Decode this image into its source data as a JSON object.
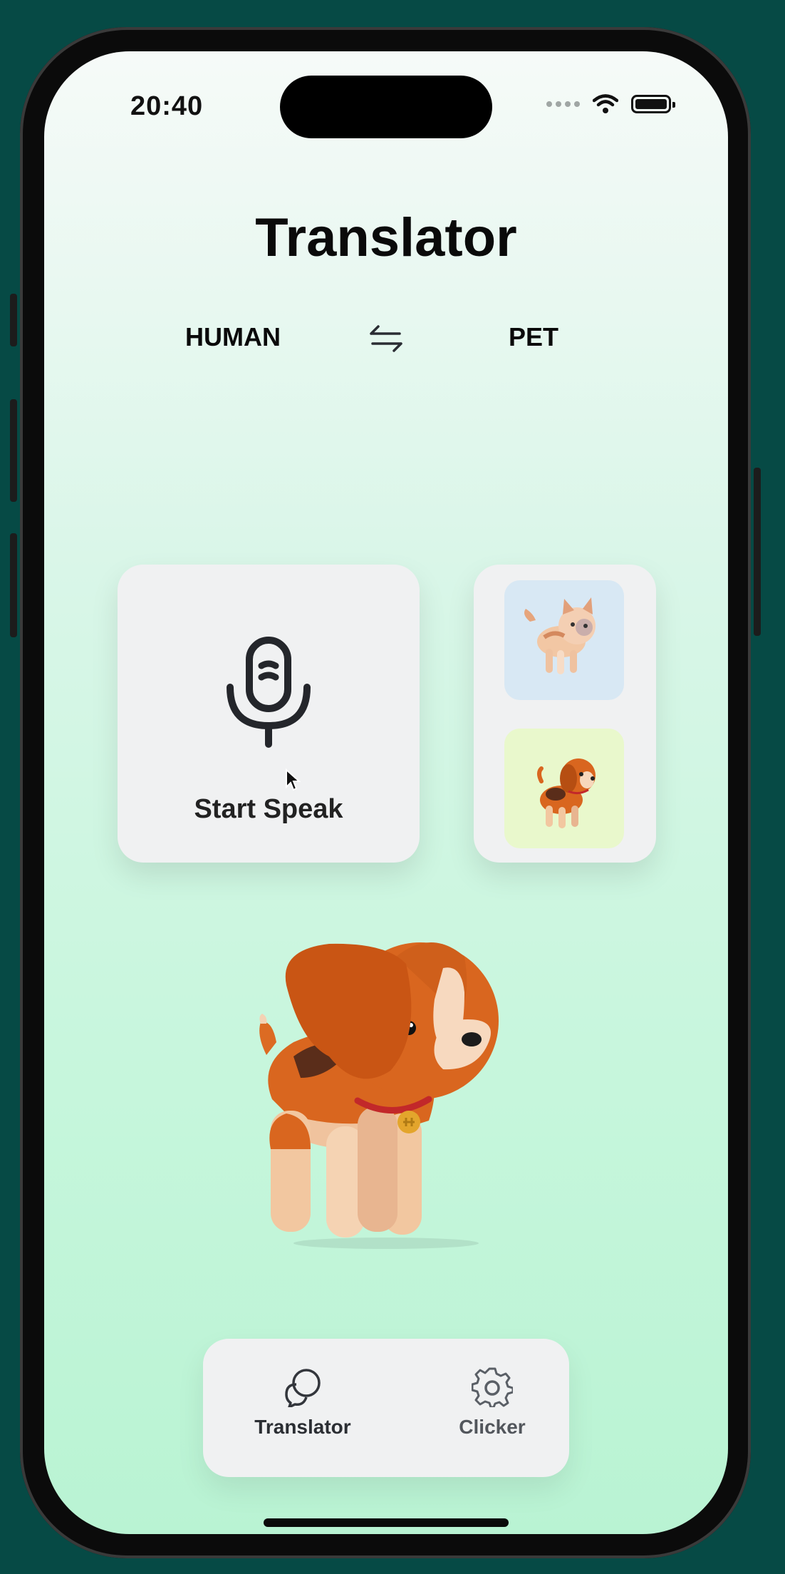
{
  "status": {
    "time": "20:40"
  },
  "header": {
    "title": "Translator"
  },
  "languages": {
    "from": "HUMAN",
    "to": "PET"
  },
  "speak": {
    "label": "Start Speak"
  },
  "tabs": [
    {
      "label": "Translator",
      "icon": "chat-bubbles-icon",
      "active": true
    },
    {
      "label": "Clicker",
      "icon": "gear-icon",
      "active": false
    }
  ],
  "colors": {
    "background": "#064a45",
    "screen_top": "#f6faf8",
    "screen_bottom": "#b9f3d3",
    "card": "#f0f1f2",
    "cat_tile": "#d8e8f4",
    "dog_tile": "#e9f8cc",
    "dog_orange": "#d9661f"
  }
}
